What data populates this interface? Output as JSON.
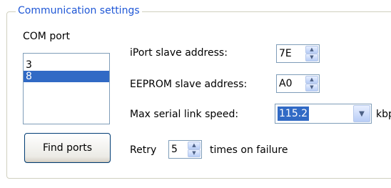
{
  "group": {
    "title": "Communication settings",
    "com_port_label": "COM port",
    "com_ports": [
      "3",
      "8"
    ],
    "selected_com_port": "8",
    "find_ports_label": "Find ports",
    "iport_label": "iPort slave address:",
    "iport_value": "7E",
    "eeprom_label": "EEPROM slave address:",
    "eeprom_value": "A0",
    "speed_label": "Max serial link speed:",
    "speed_value": "115.2",
    "speed_unit": "kbps",
    "retry_label": "Retry",
    "retry_value": "5",
    "retry_suffix": "times on failure"
  },
  "icons": {
    "spin_up": "up-arrow-icon",
    "spin_down": "down-arrow-icon",
    "combo_dropdown": "chevron-down-icon"
  },
  "colors": {
    "title": "#1f57d6",
    "selection": "#316ac5",
    "border": "#7f9db9",
    "group_border": "#d0d0bf"
  }
}
